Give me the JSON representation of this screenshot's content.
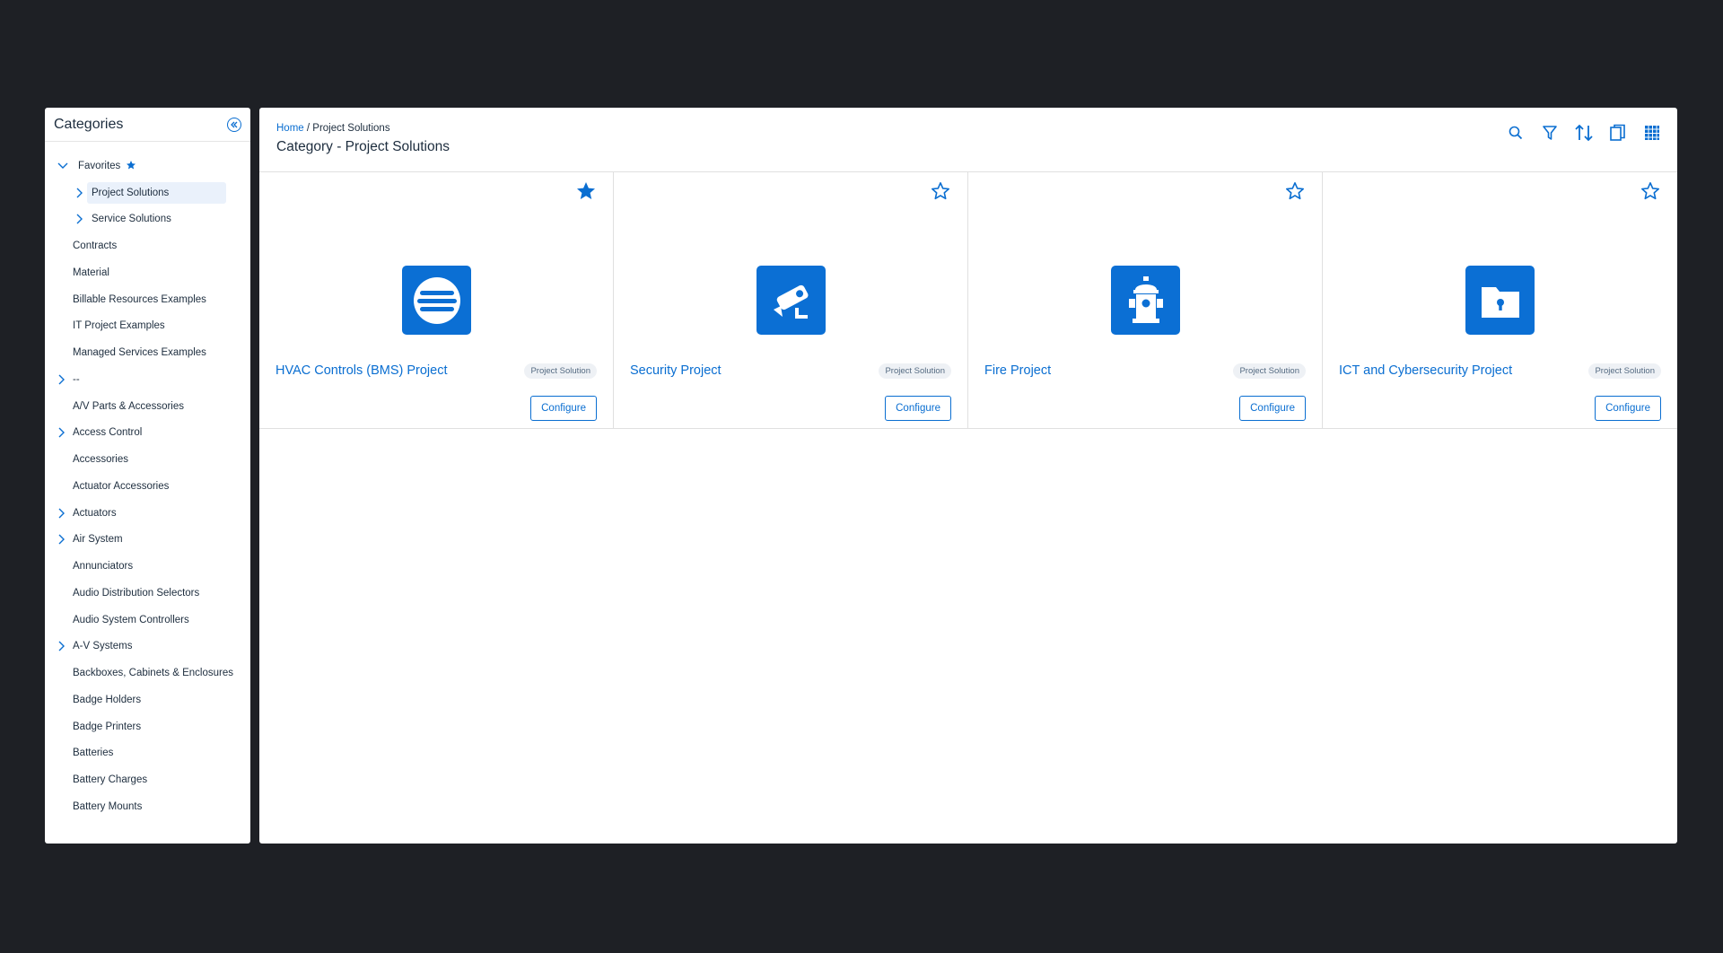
{
  "sidebar": {
    "title": "Categories",
    "favorites": {
      "label": "Favorites",
      "children": [
        {
          "label": "Project Solutions"
        },
        {
          "label": "Service Solutions"
        }
      ]
    },
    "items": [
      {
        "label": "Contracts"
      },
      {
        "label": "Material"
      },
      {
        "label": "Billable Resources Examples"
      },
      {
        "label": "IT Project Examples"
      },
      {
        "label": "Managed Services Examples"
      },
      {
        "label": "--"
      },
      {
        "label": "A/V Parts & Accessories"
      },
      {
        "label": "Access Control"
      },
      {
        "label": "Accessories"
      },
      {
        "label": "Actuator Accessories"
      },
      {
        "label": "Actuators"
      },
      {
        "label": "Air System"
      },
      {
        "label": "Annunciators"
      },
      {
        "label": "Audio Distribution Selectors"
      },
      {
        "label": "Audio System Controllers"
      },
      {
        "label": "A-V Systems"
      },
      {
        "label": "Backboxes, Cabinets & Enclosures"
      },
      {
        "label": "Badge Holders"
      },
      {
        "label": "Badge Printers"
      },
      {
        "label": "Batteries"
      },
      {
        "label": "Battery Charges"
      },
      {
        "label": "Battery Mounts"
      }
    ]
  },
  "header": {
    "breadcrumb_home": "Home",
    "breadcrumb_sep": " / ",
    "breadcrumb_current": "Project Solutions",
    "title": "Category - Project Solutions"
  },
  "cards": [
    {
      "name": "HVAC Controls (BMS) Project",
      "badge": "Project Solution",
      "button": "Configure",
      "icon": "hvac-icon",
      "favorite": true
    },
    {
      "name": "Security Project",
      "badge": "Project Solution",
      "button": "Configure",
      "icon": "security-camera-icon",
      "favorite": false
    },
    {
      "name": "Fire Project",
      "badge": "Project Solution",
      "button": "Configure",
      "icon": "fire-hydrant-icon",
      "favorite": false
    },
    {
      "name": "ICT and Cybersecurity Project",
      "badge": "Project Solution",
      "button": "Configure",
      "icon": "secure-folder-icon",
      "favorite": false
    }
  ],
  "colors": {
    "accent": "#0a6ed1",
    "tile": "#0b6fd4",
    "background": "#1e2025"
  }
}
